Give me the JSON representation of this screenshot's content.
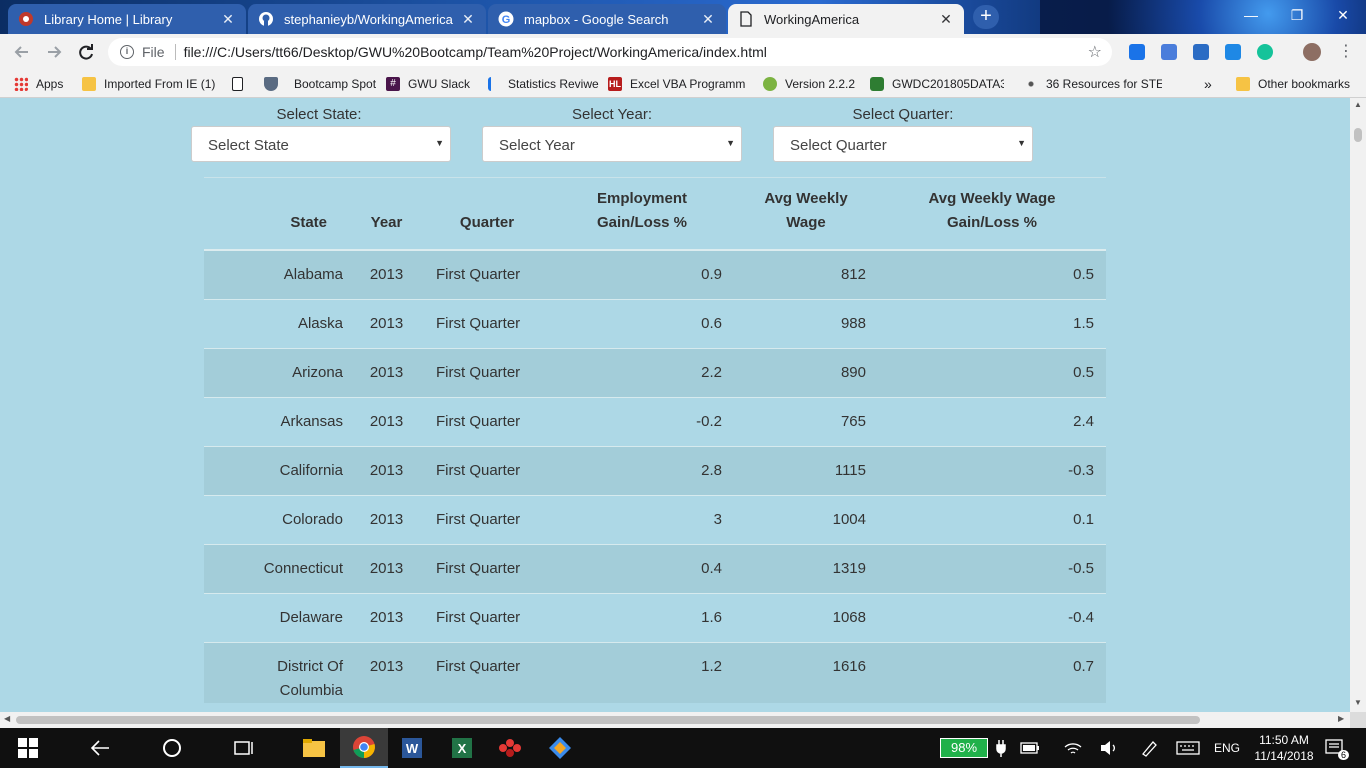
{
  "browser": {
    "tabs": [
      {
        "title": "Library Home | Library",
        "icon": "library-favicon",
        "active": false
      },
      {
        "title": "stephanieyb/WorkingAmerica",
        "icon": "github-favicon",
        "active": false
      },
      {
        "title": "mapbox - Google Search",
        "icon": "google-favicon",
        "active": false
      },
      {
        "title": "WorkingAmerica",
        "icon": "page-favicon",
        "active": true
      }
    ],
    "close_glyph": "✕",
    "new_tab_glyph": "+",
    "window_controls": {
      "minimize": "—",
      "maximize": "❐",
      "close": "✕"
    },
    "address": {
      "scheme_label": "File",
      "url": "file:///C:/Users/tt66/Desktop/GWU%20Bootcamp/Team%20Project/WorkingAmerica/index.html"
    },
    "bookmarks": [
      {
        "label": "Apps",
        "icon": "apps-grid-icon"
      },
      {
        "label": "Imported From IE (1)",
        "icon": "folder-icon"
      },
      {
        "label": "",
        "icon": "page-icon"
      },
      {
        "label": "Bootcamp Spot",
        "icon": "shield-icon"
      },
      {
        "label": "GWU Slack",
        "icon": "slack-icon"
      },
      {
        "label": "Statistics Reviwe",
        "icon": "bracket-icon"
      },
      {
        "label": "Excel VBA Programm",
        "icon": "hl-icon"
      },
      {
        "label": "Version 2.2.2",
        "icon": "leaflet-icon"
      },
      {
        "label": "GWDC201805DATA3",
        "icon": "hexagon-icon"
      },
      {
        "label": "36 Resources for STE",
        "icon": "sparkle-icon"
      }
    ],
    "overflow_glyph": "»",
    "other_bookmarks": "Other bookmarks"
  },
  "filters": {
    "state": {
      "label": "Select State:",
      "value": "Select State"
    },
    "year": {
      "label": "Select Year:",
      "value": "Select Year"
    },
    "quarter": {
      "label": "Select Quarter:",
      "value": "Select Quarter"
    },
    "arrow_glyph": "▼"
  },
  "table": {
    "headers": {
      "state": "State",
      "year": "Year",
      "quarter": "Quarter",
      "employment_line1": "Employment",
      "employment_line2": "Gain/Loss %",
      "wage_line1": "Avg Weekly",
      "wage_line2": "Wage",
      "wage_gl_line1": "Avg Weekly Wage",
      "wage_gl_line2": "Gain/Loss %"
    },
    "rows": [
      {
        "state": "Alabama",
        "year": "2013",
        "quarter": "First Quarter",
        "employment": "0.9",
        "wage": "812",
        "wage_gl": "0.5"
      },
      {
        "state": "Alaska",
        "year": "2013",
        "quarter": "First Quarter",
        "employment": "0.6",
        "wage": "988",
        "wage_gl": "1.5"
      },
      {
        "state": "Arizona",
        "year": "2013",
        "quarter": "First Quarter",
        "employment": "2.2",
        "wage": "890",
        "wage_gl": "0.5"
      },
      {
        "state": "Arkansas",
        "year": "2013",
        "quarter": "First Quarter",
        "employment": "-0.2",
        "wage": "765",
        "wage_gl": "2.4"
      },
      {
        "state": "California",
        "year": "2013",
        "quarter": "First Quarter",
        "employment": "2.8",
        "wage": "1115",
        "wage_gl": "-0.3"
      },
      {
        "state": "Colorado",
        "year": "2013",
        "quarter": "First Quarter",
        "employment": "3",
        "wage": "1004",
        "wage_gl": "0.1"
      },
      {
        "state": "Connecticut",
        "year": "2013",
        "quarter": "First Quarter",
        "employment": "0.4",
        "wage": "1319",
        "wage_gl": "-0.5"
      },
      {
        "state": "Delaware",
        "year": "2013",
        "quarter": "First Quarter",
        "employment": "1.6",
        "wage": "1068",
        "wage_gl": "-0.4"
      },
      {
        "state": "District Of Columbia",
        "year": "2013",
        "quarter": "First Quarter",
        "employment": "1.2",
        "wage": "1616",
        "wage_gl": "0.7"
      }
    ]
  },
  "taskbar": {
    "battery": "98%",
    "language": "ENG",
    "time": "11:50 AM",
    "date": "11/14/2018",
    "notifications": "6"
  },
  "colors": {
    "page_background": "#add8e6",
    "striped_row": "#a3cdd9",
    "battery_green": "#20b14a",
    "tab_active": "#f2f2f2"
  }
}
